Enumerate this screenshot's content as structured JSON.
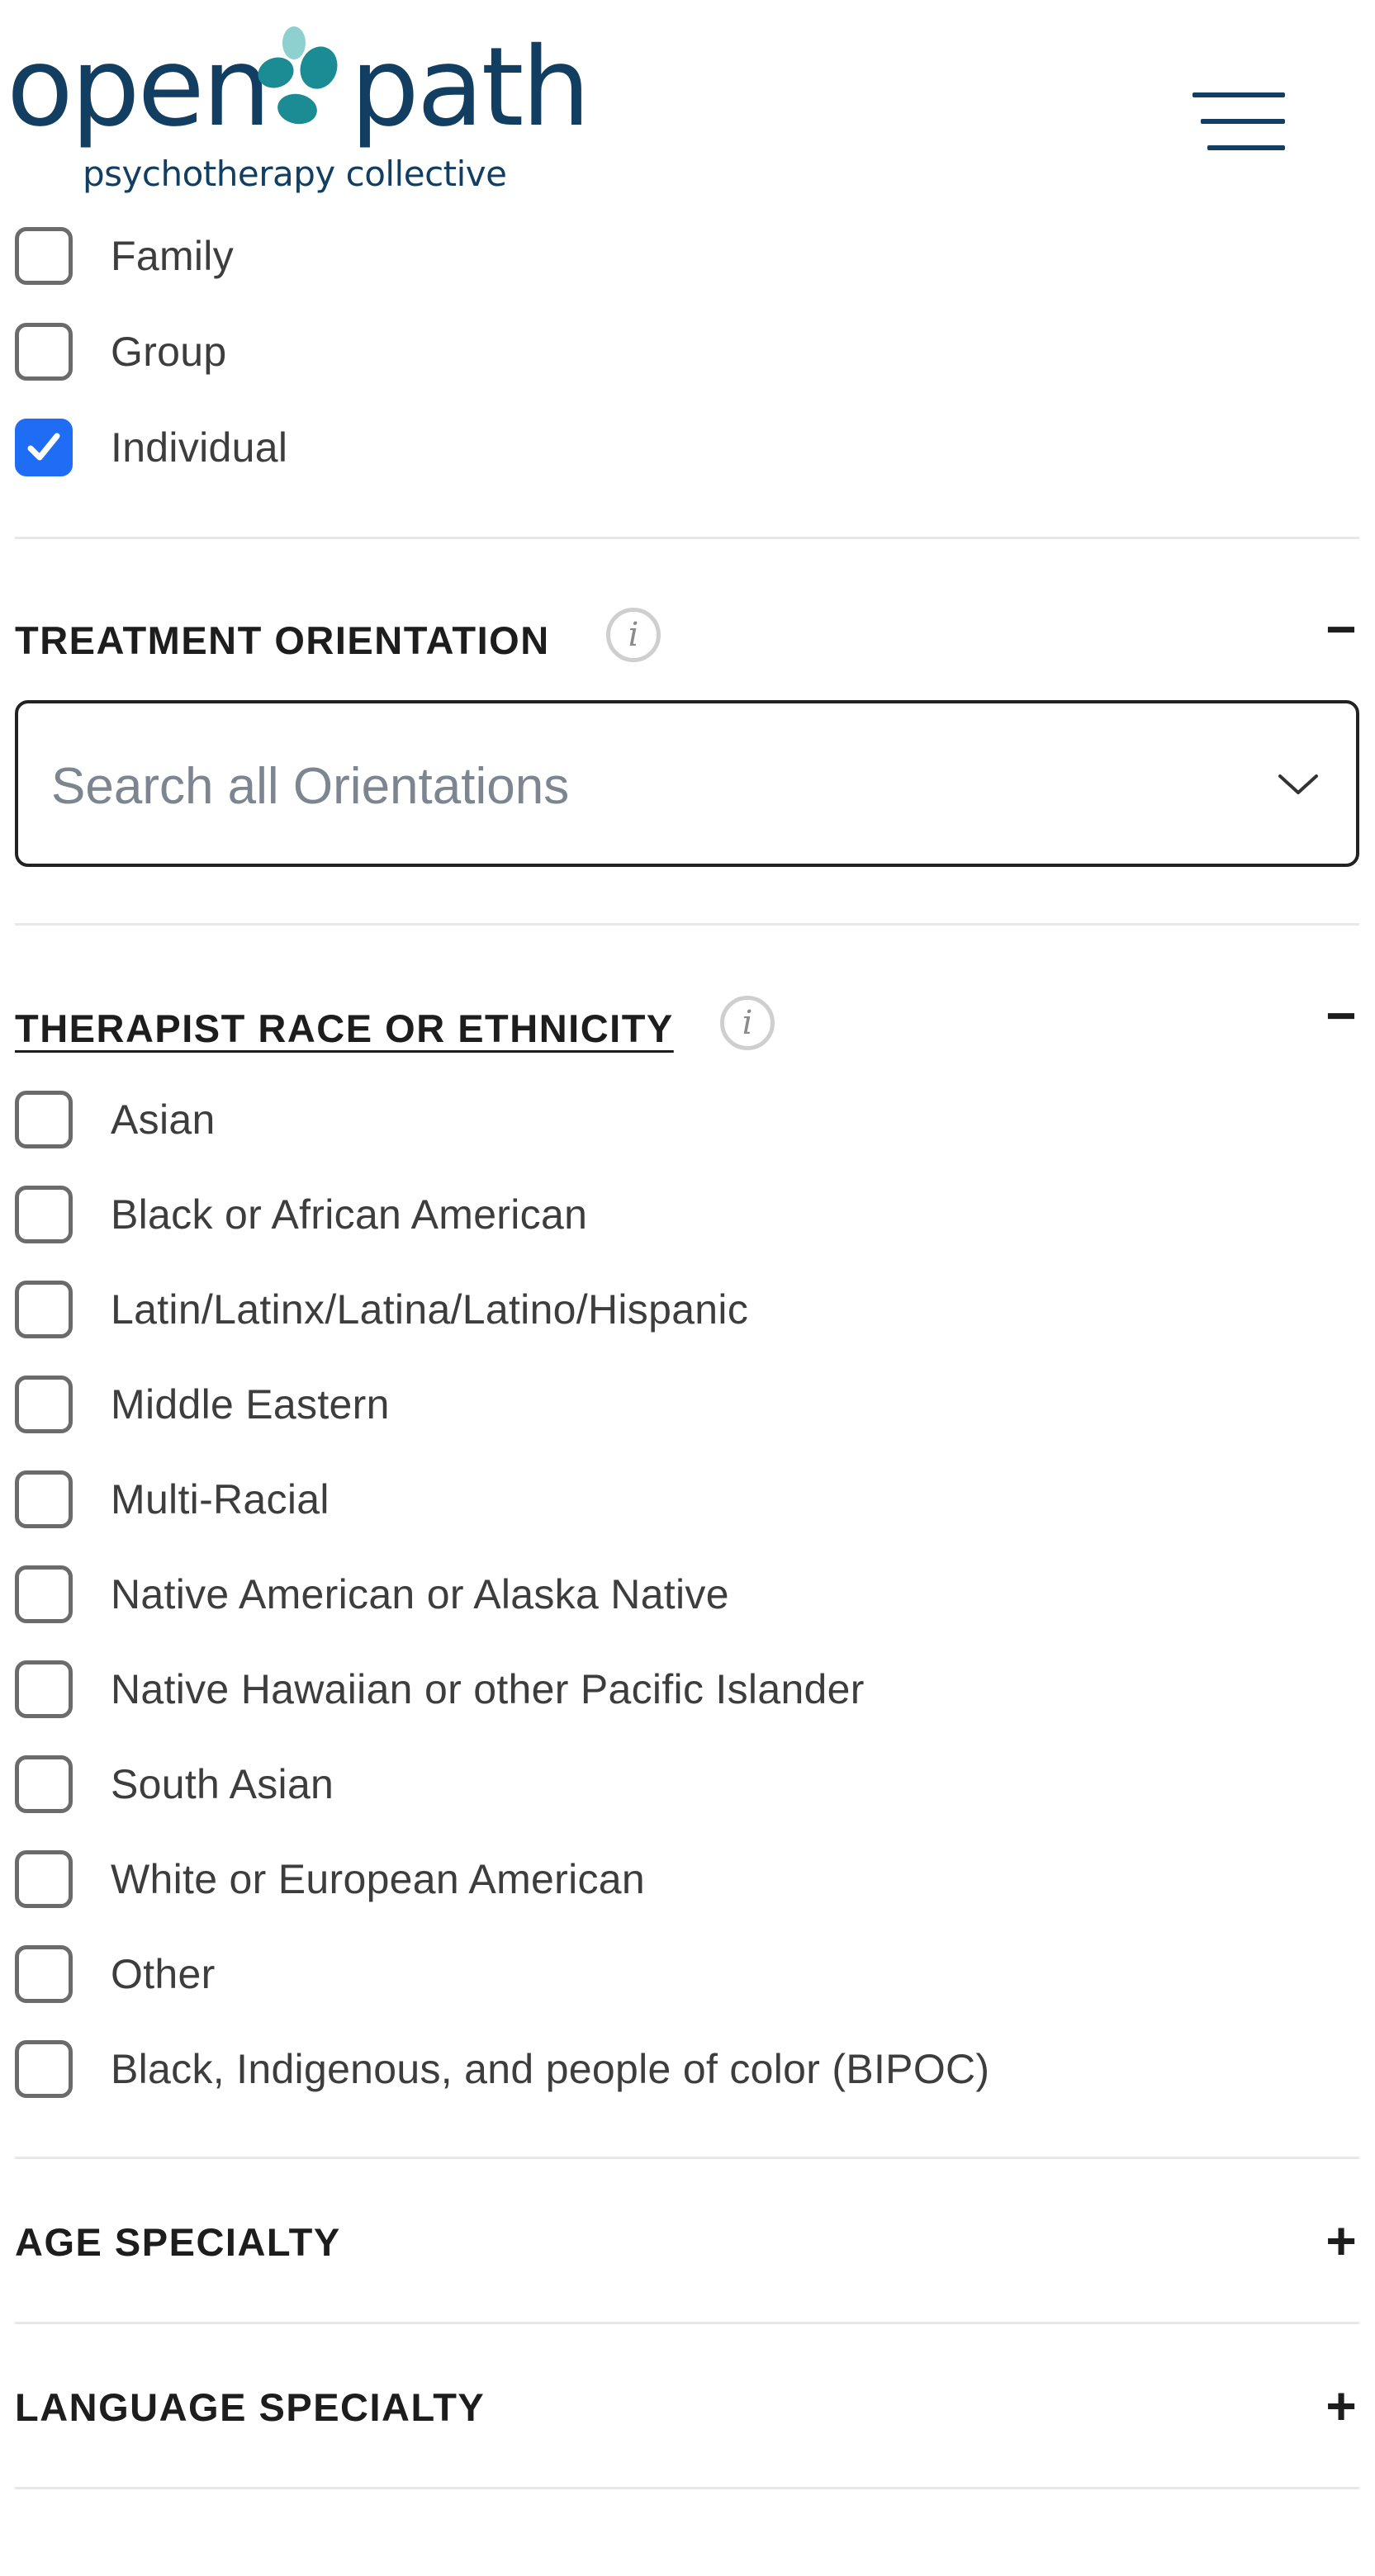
{
  "header": {
    "logo_word_1": "open",
    "logo_word_2": "path",
    "logo_tagline": "psychotherapy collective",
    "menu_icon": "hamburger-menu-icon",
    "brand_color": "#123e62",
    "leaf_color": "#1b8c94"
  },
  "session_type": {
    "options": [
      {
        "label": "Family",
        "checked": false
      },
      {
        "label": "Group",
        "checked": false
      },
      {
        "label": "Individual",
        "checked": true
      }
    ]
  },
  "treatment_orientation": {
    "title": "TREATMENT ORIENTATION",
    "info_icon": "info-icon",
    "toggle_icon": "minus-icon",
    "toggle_symbol": "−",
    "search_placeholder": "Search all Orientations",
    "dropdown_icon": "chevron-down-icon"
  },
  "therapist_race": {
    "title": "THERAPIST RACE OR ETHNICITY",
    "info_icon": "info-icon",
    "toggle_icon": "minus-icon",
    "toggle_symbol": "−",
    "options": [
      {
        "label": "Asian",
        "checked": false
      },
      {
        "label": "Black or African American",
        "checked": false
      },
      {
        "label": "Latin/Latinx/Latina/Latino/Hispanic",
        "checked": false
      },
      {
        "label": "Middle Eastern",
        "checked": false
      },
      {
        "label": "Multi-Racial",
        "checked": false
      },
      {
        "label": "Native American or Alaska Native",
        "checked": false
      },
      {
        "label": "Native Hawaiian or other Pacific Islander",
        "checked": false
      },
      {
        "label": "South Asian",
        "checked": false
      },
      {
        "label": "White or European American",
        "checked": false
      },
      {
        "label": "Other",
        "checked": false
      },
      {
        "label": "Black, Indigenous, and people of color (BIPOC)",
        "checked": false
      }
    ]
  },
  "age_specialty": {
    "title": "AGE SPECIALTY",
    "toggle_icon": "plus-icon",
    "toggle_symbol": "+"
  },
  "language_specialty": {
    "title": "LANGUAGE SPECIALTY",
    "toggle_icon": "plus-icon",
    "toggle_symbol": "+"
  },
  "colors": {
    "checkbox_checked": "#1f6cf5",
    "checkbox_border": "#6b6b6b",
    "divider": "#e8e8e8",
    "text": "#3d3d3d",
    "heading": "#1d1d1d"
  }
}
